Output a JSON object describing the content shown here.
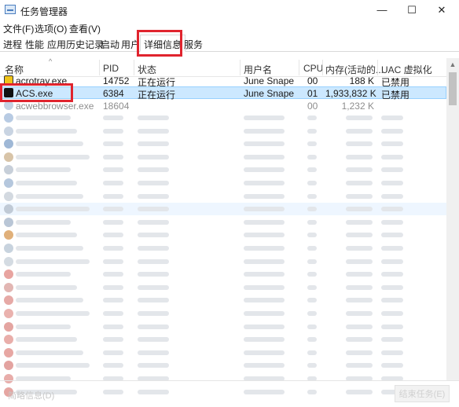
{
  "window": {
    "title": "任务管理器",
    "minimize": "—",
    "maximize": "☐",
    "close": "✕"
  },
  "menu": [
    "文件(F)",
    "选项(O)",
    "查看(V)"
  ],
  "tabs": [
    "进程",
    "性能",
    "应用历史记录",
    "启动",
    "用户",
    "详细信息",
    "服务"
  ],
  "active_tab": "详细信息",
  "columns": [
    "名称",
    "PID",
    "状态",
    "用户名",
    "CPU",
    "内存(活动的...",
    "UAC 虚拟化"
  ],
  "rows": [
    {
      "name": "acrotray.exe",
      "pid": "14752",
      "status": "正在运行",
      "user": "June Snape",
      "cpu": "00",
      "mem": "188 K",
      "uac": "已禁用"
    },
    {
      "name": "ACS.exe",
      "pid": "6384",
      "status": "正在运行",
      "user": "June Snape",
      "cpu": "01",
      "mem": "1,933,832 K",
      "uac": "已禁用"
    },
    {
      "name": "acwebbrowser.exe",
      "pid": "18604",
      "status": "",
      "user": "",
      "cpu": "00",
      "mem": "1,232 K",
      "uac": ""
    }
  ],
  "bottom": {
    "fewer_details": "简略信息(D)",
    "end_task": "结束任务(E)"
  },
  "colors": {
    "highlight": "#e0242e",
    "selection": "#cce8ff"
  }
}
